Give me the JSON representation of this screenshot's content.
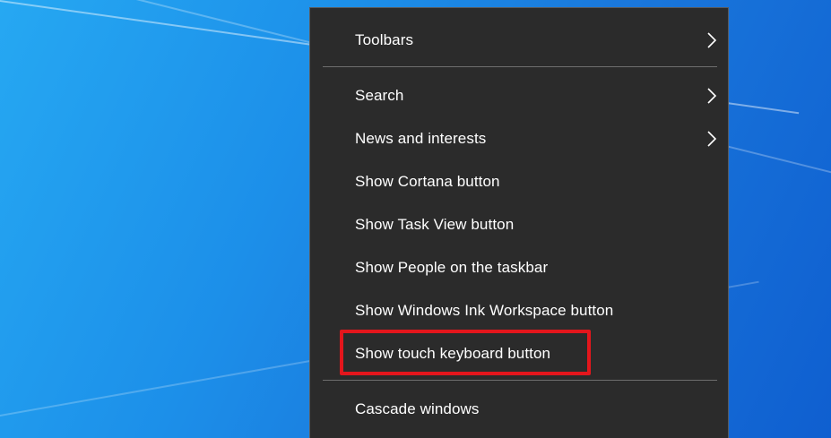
{
  "context_menu": {
    "items": [
      {
        "label": "Toolbars",
        "has_submenu": true
      },
      {
        "label": "Search",
        "has_submenu": true
      },
      {
        "label": "News and interests",
        "has_submenu": true
      },
      {
        "label": "Show Cortana button",
        "has_submenu": false
      },
      {
        "label": "Show Task View button",
        "has_submenu": false
      },
      {
        "label": "Show People on the taskbar",
        "has_submenu": false
      },
      {
        "label": "Show Windows Ink Workspace button",
        "has_submenu": false
      },
      {
        "label": "Show touch keyboard button",
        "has_submenu": false,
        "highlighted": true
      },
      {
        "label": "Cascade windows",
        "has_submenu": false
      }
    ]
  },
  "colors": {
    "menu_background": "#2b2b2b",
    "menu_text": "#ffffff",
    "separator": "#6e6e6e",
    "highlight_border": "#e3161c",
    "desktop_blue": "#1a78dc"
  },
  "icons": {
    "submenu": "chevron-right-icon"
  }
}
